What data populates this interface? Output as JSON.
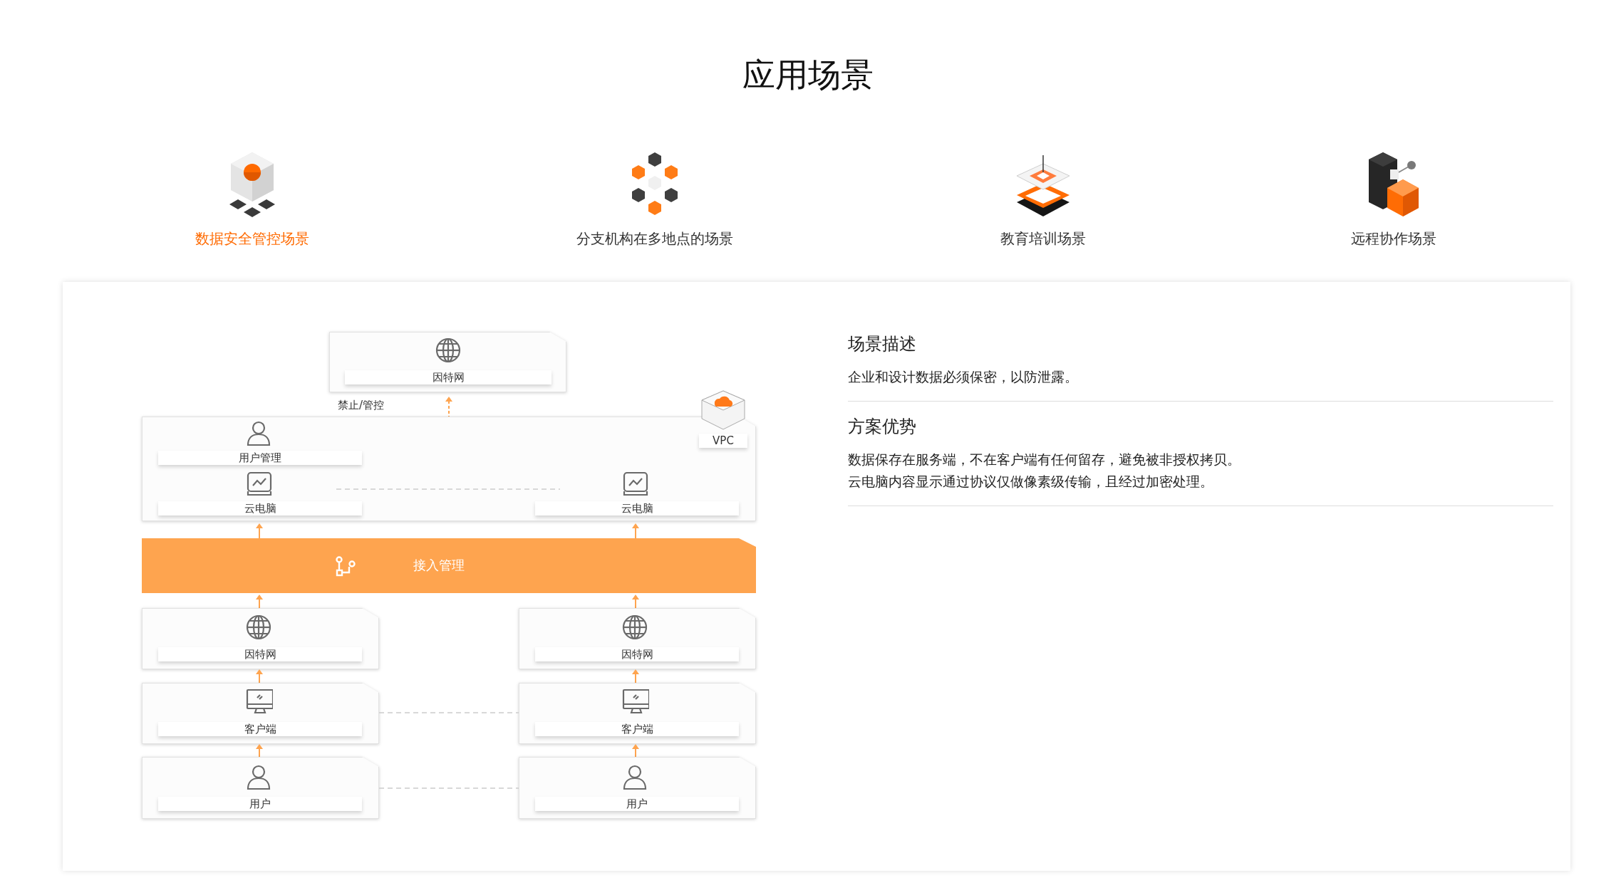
{
  "title": "应用场景",
  "scenarios": [
    {
      "label": "数据安全管控场景",
      "selected": true
    },
    {
      "label": "分支机构在多地点的场景",
      "selected": false
    },
    {
      "label": "教育培训场景",
      "selected": false
    },
    {
      "label": "远程协作场景",
      "selected": false
    }
  ],
  "diagram": {
    "top_node": {
      "label": "因特网"
    },
    "control_label": "禁止/管控",
    "vpc": {
      "label": "VPC",
      "user_management": {
        "label": "用户管理"
      },
      "cloud_pcs": [
        {
          "label": "云电脑"
        },
        {
          "label": "云电脑"
        }
      ]
    },
    "access_bar": {
      "label": "接入管理"
    },
    "branches": [
      {
        "internet": "因特网",
        "client": "客户端",
        "user": "用户"
      },
      {
        "internet": "因特网",
        "client": "客户端",
        "user": "用户"
      }
    ]
  },
  "details": [
    {
      "heading": "场景描述",
      "paragraphs": [
        "企业和设计数据必须保密，以防泄露。"
      ]
    },
    {
      "heading": "方案优势",
      "paragraphs": [
        "数据保存在服务端，不在客户端有任何留存，避免被非授权拷贝。",
        "云电脑内容显示通过协议仅做像素级传输，且经过加密处理。"
      ]
    }
  ]
}
